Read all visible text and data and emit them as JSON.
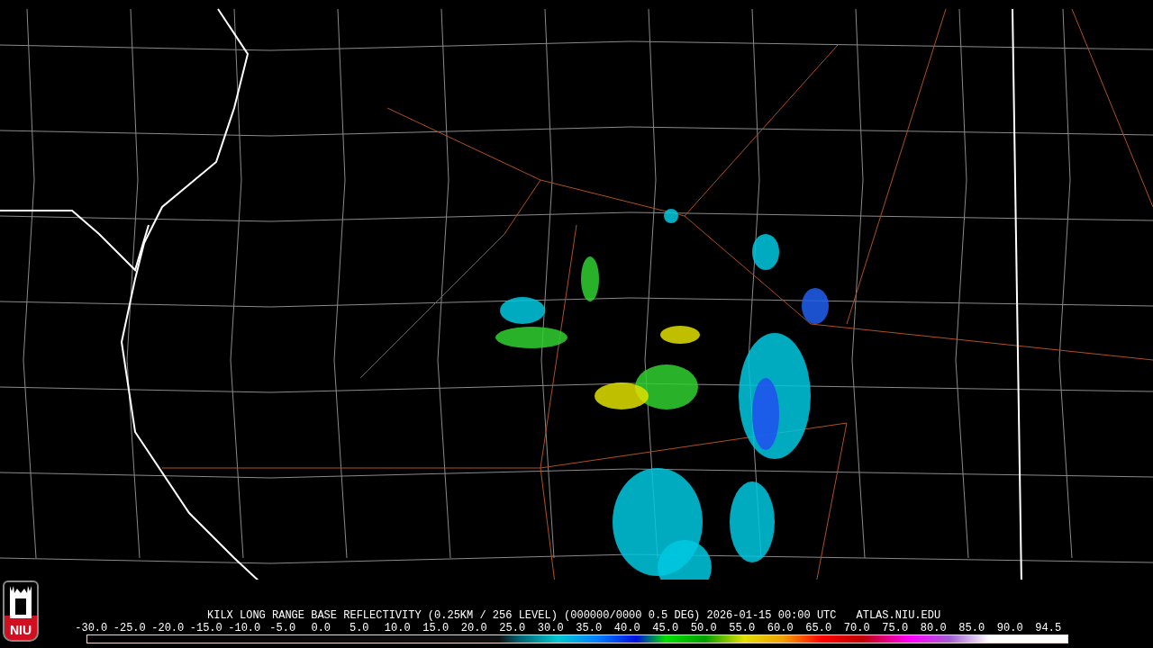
{
  "logo": {
    "text": "NIU"
  },
  "product_title": "KILX LONG RANGE BASE REFLECTIVITY (0.25KM / 256 LEVEL) (000000/0000 0.5 DEG) 2026-01-15 00:00 UTC",
  "site": "ATLAS.NIU.EDU",
  "colorbar": {
    "ticks": [
      "-30.0",
      "-25.0",
      "-20.0",
      "-15.0",
      "-10.0",
      "-5.0",
      "0.0",
      "5.0",
      "10.0",
      "15.0",
      "20.0",
      "25.0",
      "30.0",
      "35.0",
      "40.0",
      "45.0",
      "50.0",
      "55.0",
      "60.0",
      "65.0",
      "70.0",
      "75.0",
      "80.0",
      "85.0",
      "90.0",
      "94.5"
    ]
  }
}
